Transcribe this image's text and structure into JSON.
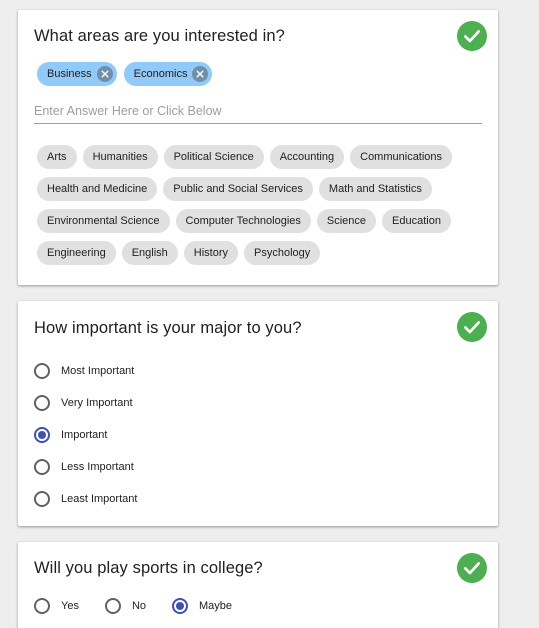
{
  "colors": {
    "accent": "#3f51b5",
    "success": "#4caf50",
    "selected_chip": "#90caf9",
    "chip": "#e0e0e0"
  },
  "areas": {
    "title": "What areas are you interested in?",
    "status_icon": "check-circle-icon",
    "selected": [
      {
        "label": "Business"
      },
      {
        "label": "Economics"
      }
    ],
    "input": {
      "value": "",
      "placeholder": "Enter Answer Here or Click Below"
    },
    "options": [
      {
        "label": "Arts"
      },
      {
        "label": "Humanities"
      },
      {
        "label": "Political Science"
      },
      {
        "label": "Accounting"
      },
      {
        "label": "Communications"
      },
      {
        "label": "Health and Medicine"
      },
      {
        "label": "Public and Social Services"
      },
      {
        "label": "Math and Statistics"
      },
      {
        "label": "Environmental Science"
      },
      {
        "label": "Computer Technologies"
      },
      {
        "label": "Science"
      },
      {
        "label": "Education"
      },
      {
        "label": "Engineering"
      },
      {
        "label": "English"
      },
      {
        "label": "History"
      },
      {
        "label": "Psychology"
      }
    ]
  },
  "major": {
    "title": "How important is your major to you?",
    "status_icon": "check-circle-icon",
    "selected": "Important",
    "options": [
      {
        "label": "Most Important"
      },
      {
        "label": "Very Important"
      },
      {
        "label": "Important"
      },
      {
        "label": "Less Important"
      },
      {
        "label": "Least Important"
      }
    ]
  },
  "sports": {
    "title": "Will you play sports in college?",
    "status_icon": "check-circle-icon",
    "selected": "Maybe",
    "options": [
      {
        "label": "Yes"
      },
      {
        "label": "No"
      },
      {
        "label": "Maybe"
      }
    ]
  }
}
